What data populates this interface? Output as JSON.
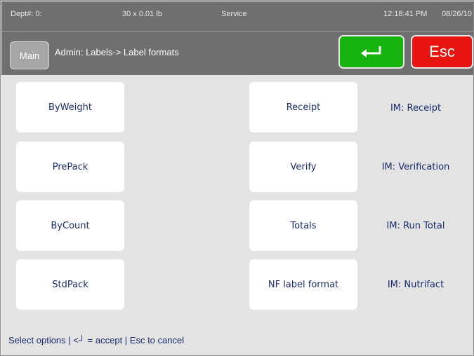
{
  "status": {
    "dept": "Dept#: 0:",
    "weight": "30 x 0.01 lb",
    "mode": "Service",
    "time": "12:18:41 PM",
    "date": "08/26/10"
  },
  "header": {
    "main_label": "Main",
    "title": "Admin: Labels-> Label formats",
    "enter_icon": "enter-arrow-icon",
    "esc_label": "Esc",
    "colors": {
      "enter": "#17b30f",
      "esc": "#e8140f",
      "bar": "#6f6f6f"
    }
  },
  "formats": {
    "left": [
      {
        "label": "ByWeight"
      },
      {
        "label": "PrePack"
      },
      {
        "label": "ByCount"
      },
      {
        "label": "StdPack"
      }
    ],
    "right": [
      {
        "label": "Receipt",
        "im": "IM: Receipt"
      },
      {
        "label": "Verify",
        "im": "IM: Verification"
      },
      {
        "label": "Totals",
        "im": "IM: Run Total"
      },
      {
        "label": "NF label format",
        "im": "IM: Nutrifact"
      }
    ]
  },
  "hint": "Select options | <┘ = accept | Esc to cancel"
}
